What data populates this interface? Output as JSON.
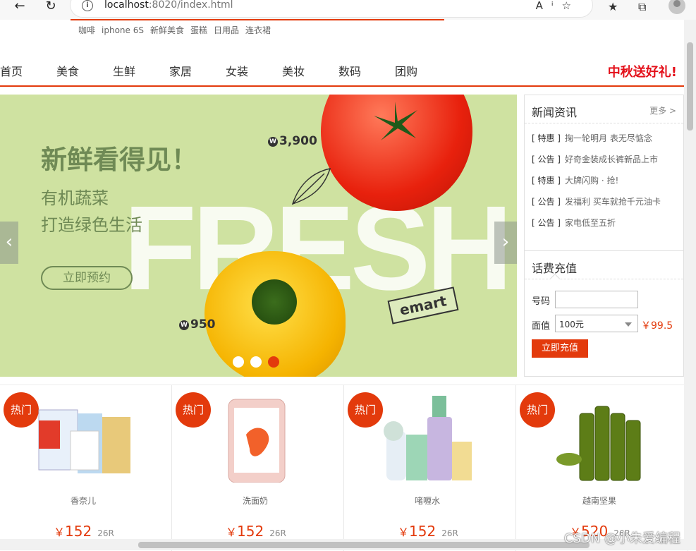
{
  "browser": {
    "url_host": "localhost",
    "url_rest": ":8020/index.html",
    "icons": [
      "back-icon",
      "reload-icon",
      "info-icon",
      "read-aloud-icon",
      "add-favorite-icon",
      "favorites-icon",
      "collections-icon",
      "profile-icon"
    ]
  },
  "hot_words": [
    "咖啡",
    "iphone 6S",
    "新鲜美食",
    "蛋糕",
    "日用品",
    "连衣裙"
  ],
  "nav": {
    "items": [
      "首页",
      "美食",
      "生鲜",
      "家居",
      "女装",
      "美妆",
      "数码",
      "团购"
    ],
    "promo": "中秋送好礼!"
  },
  "banner": {
    "title": "新鲜看得见！",
    "subtitle_line1": "有机蔬菜",
    "subtitle_line2": "打造绿色生活",
    "button": "立即预约",
    "bg_word": "FRESH",
    "price1": "3,900",
    "price2": "950",
    "currency_mark": "W",
    "brand": "emart",
    "prev": "‹",
    "next": "›",
    "active_dot": 3,
    "dot_count": 3
  },
  "news": {
    "title": "新闻资讯",
    "more": "更多 >",
    "items": [
      {
        "tag": "[ 特惠 ]",
        "text": "掬一轮明月 表无尽惦念"
      },
      {
        "tag": "[ 公告 ]",
        "text": "好奇金装成长裤新品上市"
      },
      {
        "tag": "[ 特惠 ]",
        "text": "大牌闪购 · 抢!"
      },
      {
        "tag": "[ 公告 ]",
        "text": "发福利 买车就抢千元油卡"
      },
      {
        "tag": "[ 公告 ]",
        "text": "家电低至五折"
      }
    ]
  },
  "recharge": {
    "title": "话费充值",
    "phone_label": "号码",
    "phone_value": "",
    "amount_label": "面值",
    "amount_value": "100元",
    "price": "￥99.5",
    "button": "立即充值"
  },
  "products": [
    {
      "badge": "热门",
      "name": "香奈儿",
      "price": "152",
      "sold": "26R",
      "image": "milk-box"
    },
    {
      "badge": "热门",
      "name": "洗面奶",
      "price": "152",
      "sold": "26R",
      "image": "iphone"
    },
    {
      "badge": "热门",
      "name": "啫喱水",
      "price": "152",
      "sold": "26R",
      "image": "clinique-bottles"
    },
    {
      "badge": "热门",
      "name": "越南坚果",
      "price": "520",
      "sold": "26R",
      "image": "olive-oil-bottles"
    }
  ],
  "price_currency": "￥",
  "watermark": "CSDN @小朱爱编程",
  "colors": {
    "accent": "#e33a0c",
    "promo": "#e4101a",
    "banner_bg": "#cfe2a1",
    "banner_text": "#6f8a55"
  }
}
